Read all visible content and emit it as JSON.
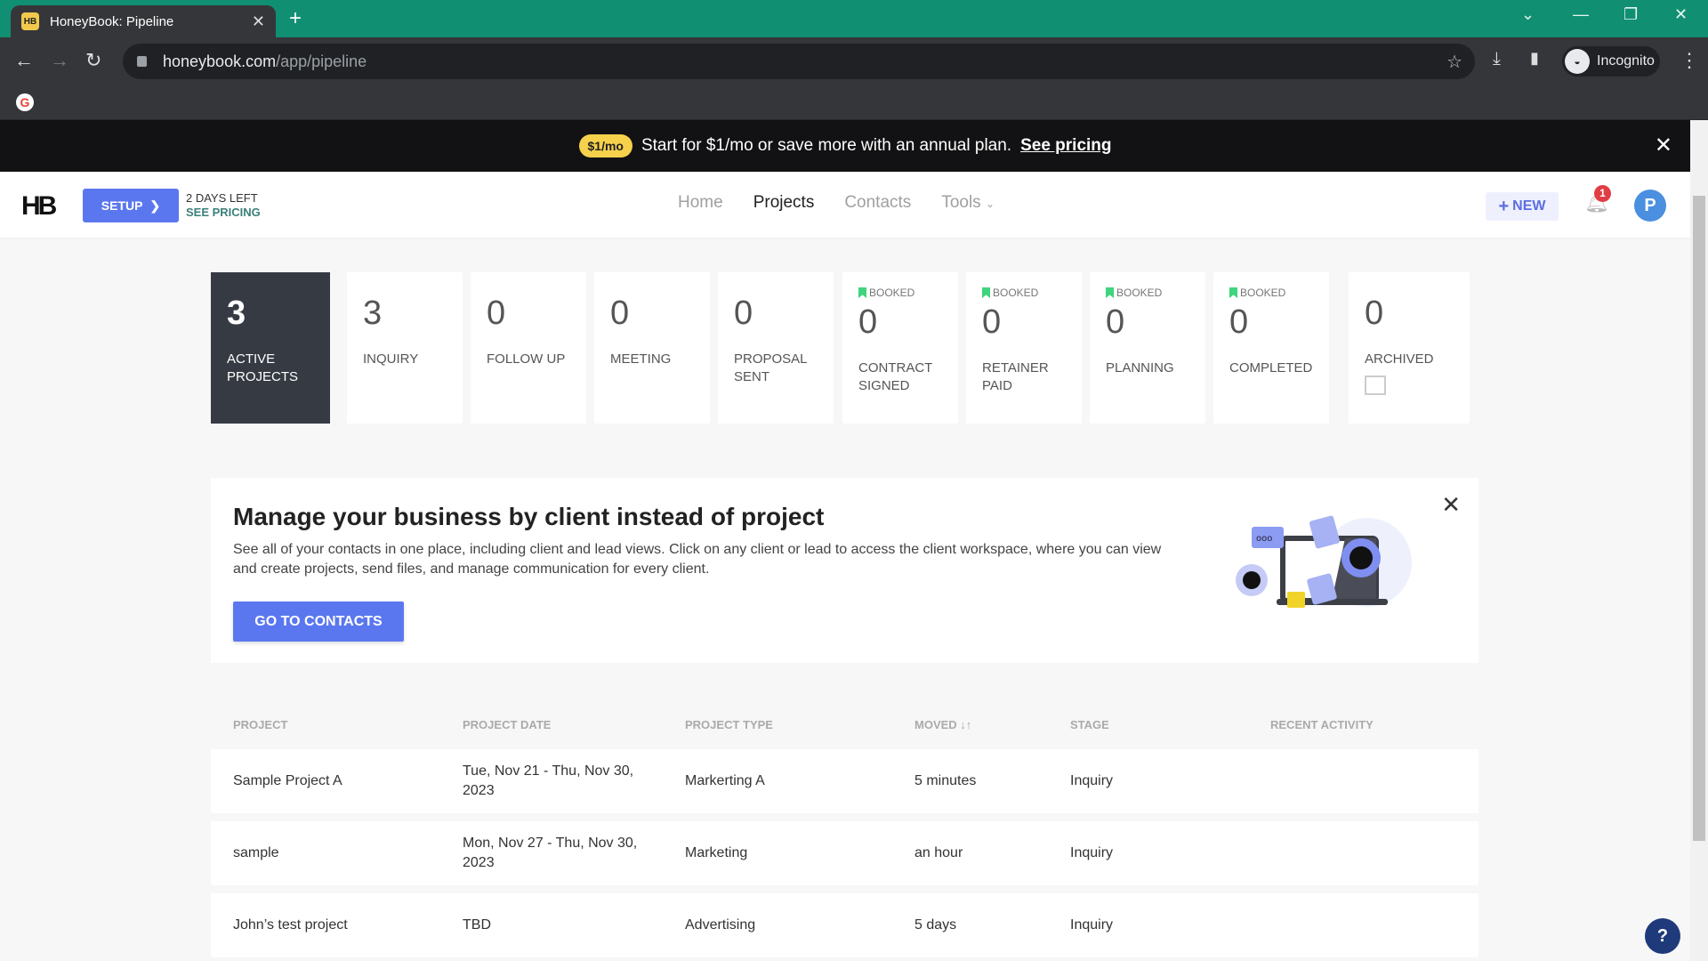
{
  "browser": {
    "tab_title": "HoneyBook: Pipeline",
    "tab_favicon": "HB",
    "url_host": "honeybook.com",
    "url_path": "/app/pipeline",
    "profile_label": "Incognito"
  },
  "banner": {
    "pill": "$1/mo",
    "text": "Start for $1/mo or save more with an annual plan.",
    "link": "See pricing"
  },
  "header": {
    "logo": "HB",
    "setup_label": "SETUP",
    "trial_days": "2 DAYS LEFT",
    "trial_link": "SEE PRICING",
    "nav": [
      {
        "label": "Home",
        "active": false
      },
      {
        "label": "Projects",
        "active": true
      },
      {
        "label": "Contacts",
        "active": false
      },
      {
        "label": "Tools",
        "active": false
      }
    ],
    "new_label": "NEW",
    "notification_count": "1",
    "avatar_initial": "P"
  },
  "stages": [
    {
      "count": "3",
      "label": "Active Projects",
      "booked": false
    },
    {
      "count": "3",
      "label": "Inquiry",
      "booked": false
    },
    {
      "count": "0",
      "label": "Follow Up",
      "booked": false
    },
    {
      "count": "0",
      "label": "Meeting",
      "booked": false
    },
    {
      "count": "0",
      "label": "Proposal Sent",
      "booked": false
    },
    {
      "count": "0",
      "label": "Contract Signed",
      "booked": true
    },
    {
      "count": "0",
      "label": "Retainer Paid",
      "booked": true
    },
    {
      "count": "0",
      "label": "Planning",
      "booked": true
    },
    {
      "count": "0",
      "label": "Completed",
      "booked": true
    },
    {
      "count": "0",
      "label": "Archived",
      "booked": false
    }
  ],
  "booked_label": "BOOKED",
  "promo": {
    "title": "Manage your business by client instead of project",
    "body": "See all of your contacts in one place, including client and lead views. Click on any client or lead to access the client workspace, where you can view and create projects, send files, and manage communication for every client.",
    "button": "GO TO CONTACTS"
  },
  "table": {
    "headers": [
      "Project",
      "Project Date",
      "Project Type",
      "Moved",
      "Stage",
      "Recent Activity"
    ],
    "sort_indicator": "↓↑",
    "rows": [
      {
        "project": "Sample Project A",
        "date": "Tue, Nov 21 - Thu, Nov 30, 2023",
        "type": "Markerting A",
        "moved": "5 minutes",
        "stage": "Inquiry",
        "activity": ""
      },
      {
        "project": "sample",
        "date": "Mon, Nov 27 - Thu, Nov 30, 2023",
        "type": "Marketing",
        "moved": "an hour",
        "stage": "Inquiry",
        "activity": ""
      },
      {
        "project": "John’s test project",
        "date": "TBD",
        "type": "Advertising",
        "moved": "5 days",
        "stage": "Inquiry",
        "activity": ""
      }
    ]
  },
  "help_label": "?"
}
